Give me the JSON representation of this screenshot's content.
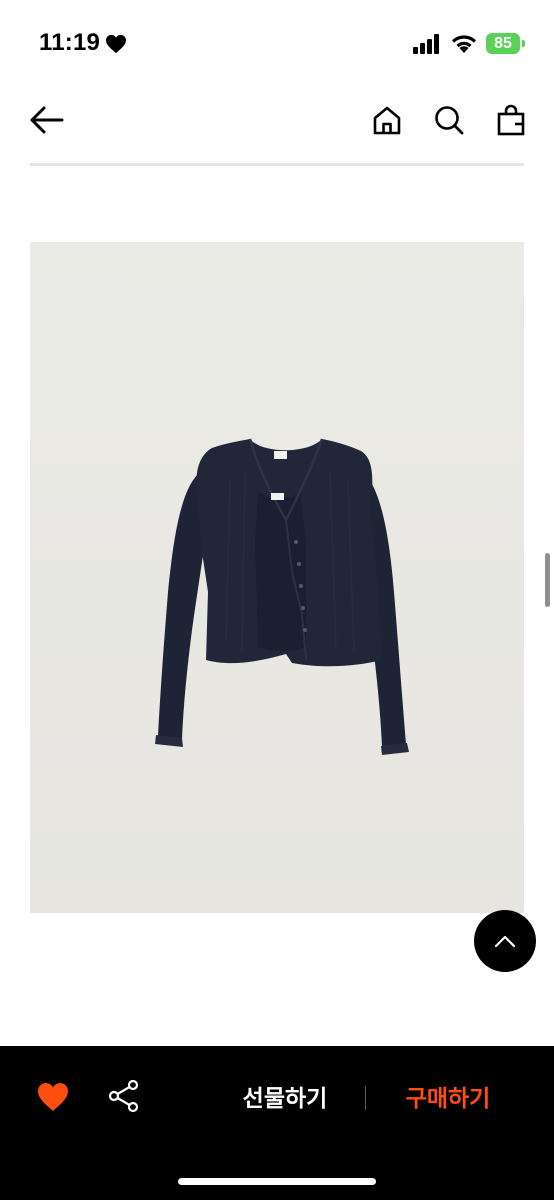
{
  "status_bar": {
    "time": "11:19",
    "battery": "85"
  },
  "nav": {
    "back_icon": "arrow-left-icon",
    "home_icon": "home-icon",
    "search_icon": "search-icon",
    "bag_icon": "shopping-bag-icon"
  },
  "product": {
    "image": "navy-knit-cardigan-set-photo",
    "garment_color": "#1e2436",
    "background_color": "#e9e8e3"
  },
  "scroll_top": {
    "icon": "chevron-up-icon"
  },
  "bottom_bar": {
    "like_icon": "heart-icon",
    "like_color": "#ff4e10",
    "share_icon": "share-icon",
    "gift_label": "선물하기",
    "buy_label": "구매하기",
    "buy_color": "#ff4e10"
  }
}
